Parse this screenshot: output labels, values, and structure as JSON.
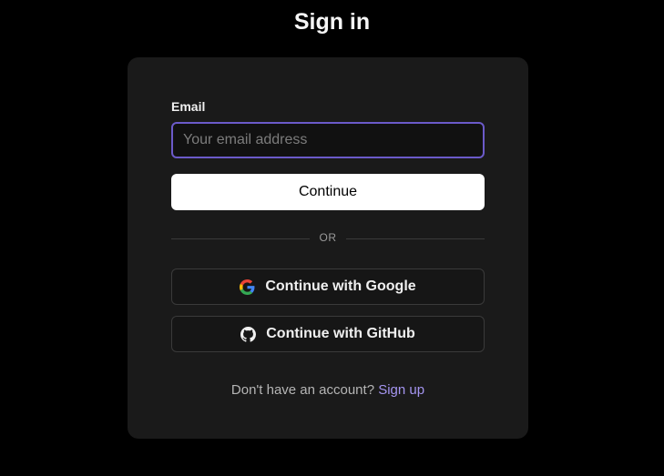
{
  "header": {
    "title": "Sign in"
  },
  "form": {
    "email_label": "Email",
    "email_placeholder": "Your email address",
    "email_value": "",
    "continue_label": "Continue",
    "divider_text": "OR"
  },
  "oauth": {
    "google_label": "Continue with Google",
    "google_icon": "google-icon",
    "github_label": "Continue with GitHub",
    "github_icon": "github-icon"
  },
  "footer": {
    "prompt": "Don't have an account?",
    "signup_label": "Sign up"
  },
  "colors": {
    "background": "#000000",
    "card": "#1a1a1a",
    "input_focus_border": "#6b5ac9",
    "link": "#a495f0",
    "primary_button": "#ffffff"
  }
}
